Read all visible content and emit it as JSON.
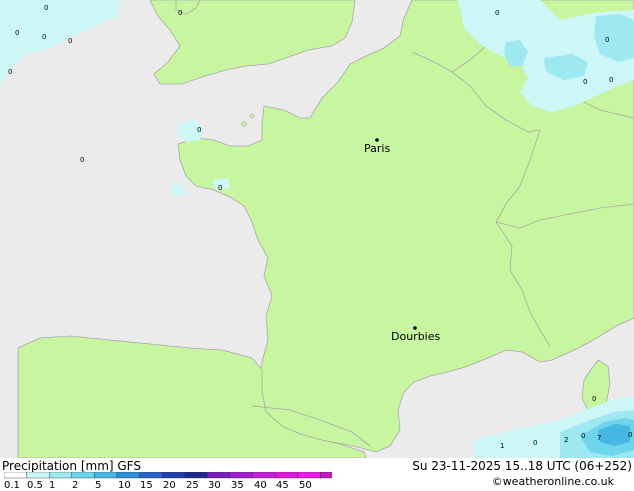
{
  "map": {
    "cities": [
      {
        "name": "Paris"
      },
      {
        "name": "Dourbies"
      }
    ],
    "precip_value_labels": [
      "0",
      "0",
      "0",
      "0",
      "0",
      "0",
      "0",
      "0",
      "0",
      "0",
      "0",
      "0",
      "0",
      "0",
      "0",
      "1",
      "0",
      "2",
      "7",
      "0"
    ]
  },
  "footer": {
    "title": "Precipitation [mm] GFS",
    "datetime": "Su 23-11-2025 15..18 UTC (06+252)",
    "credit": "©weatheronline.co.uk",
    "legend_ticks": [
      "0.1",
      "0.5",
      "1",
      "2",
      "5",
      "10",
      "15",
      "20",
      "25",
      "30",
      "35",
      "40",
      "45",
      "50"
    ],
    "legend_colors": [
      "#ffffff",
      "#cdf7f7",
      "#9ee9f1",
      "#6fd5ec",
      "#46b8e4",
      "#2f8fd8",
      "#2a62c8",
      "#1f3fad",
      "#1d2a8c",
      "#7a1fbe",
      "#a21fd0",
      "#c21fd6",
      "#e01ad8",
      "#f01ae8",
      "#c01ab8"
    ],
    "colors": {
      "land": "#c8f5a0",
      "sea": "#ebebeb",
      "border": "#a8a8a8"
    }
  }
}
